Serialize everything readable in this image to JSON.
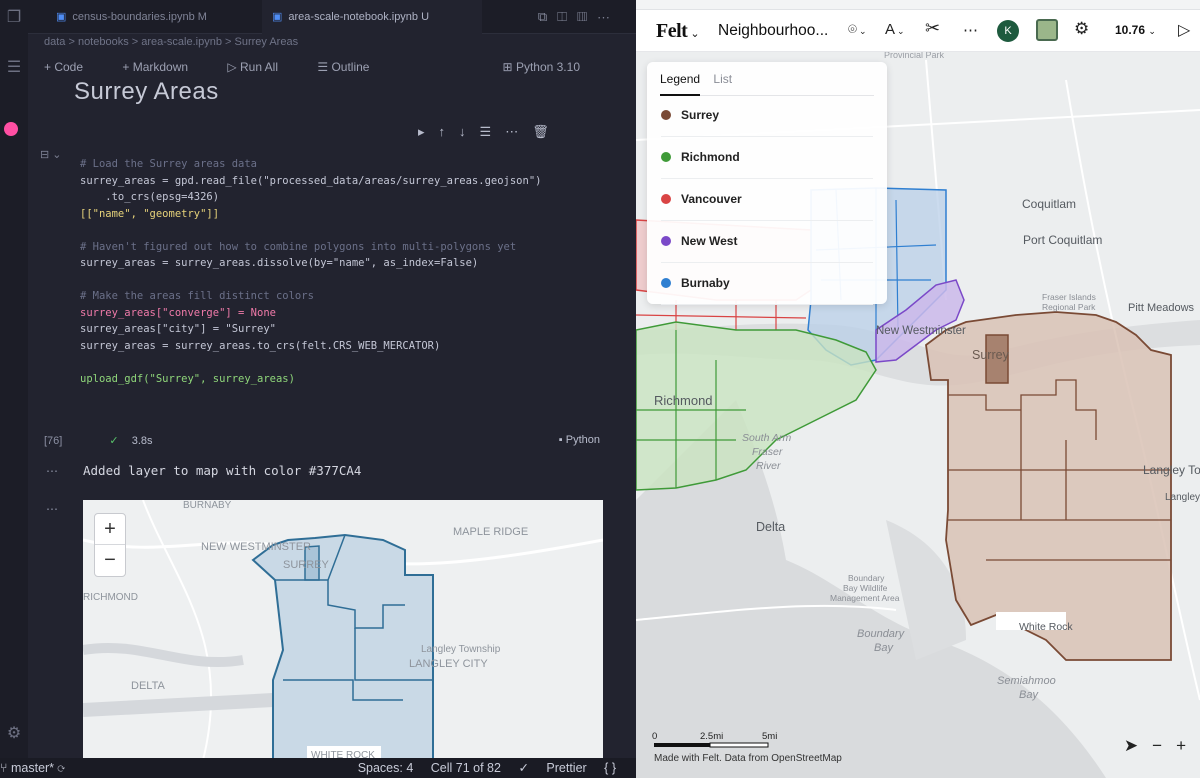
{
  "vscode": {
    "tabs": [
      {
        "label": "census-boundaries.ipynb M",
        "active": false
      },
      {
        "label": "area-scale-notebook.ipynb U",
        "active": true
      }
    ],
    "breadcrumb": "data > notebooks > area-scale.ipynb > Surrey Areas",
    "notebook_toolbar": {
      "code": "Code",
      "markdown": "Markdown",
      "run_all": "Run All",
      "outline": "Outline",
      "kernel": "Python 3.10"
    },
    "markdown_heading": "Surrey Areas",
    "code_lines": [
      {
        "cls": "c-comment",
        "text": "# Load the Surrey areas data"
      },
      {
        "cls": "c-var",
        "text": "surrey_areas = gpd.read_file(\"processed_data/areas/surrey_areas.geojson\")"
      },
      {
        "cls": "c-var",
        "text": "    .to_crs(epsg=4326)"
      },
      {
        "cls": "c-str",
        "text": "[[\"name\", \"geometry\"]]"
      },
      {
        "cls": "c-var",
        "text": ""
      },
      {
        "cls": "c-comment",
        "text": "# Haven't figured out how to combine polygons into multi-polygons yet"
      },
      {
        "cls": "c-var",
        "text": "surrey_areas = surrey_areas.dissolve(by=\"name\", as_index=False)"
      },
      {
        "cls": "c-var",
        "text": ""
      },
      {
        "cls": "c-comment",
        "text": "# Make the areas fill distinct colors"
      },
      {
        "cls": "c-pink",
        "text": "surrey_areas[\"converge\"] = None"
      },
      {
        "cls": "c-var",
        "text": "surrey_areas[\"city\"] = \"Surrey\""
      },
      {
        "cls": "c-var",
        "text": "surrey_areas = surrey_areas.to_crs(felt.CRS_WEB_MERCATOR)"
      },
      {
        "cls": "c-var",
        "text": ""
      },
      {
        "cls": "c-green",
        "text": "upload_gdf(\"Surrey\", surrey_areas)"
      }
    ],
    "cell_exec_count": "[76]",
    "cell_status": {
      "duration": "3.8s",
      "language": "Python"
    },
    "output_text": "Added layer to map with color  #377CA4",
    "mini_map": {
      "zoom_in": "+",
      "zoom_out": "−",
      "labels": [
        "BURNABY",
        "NEW WESTMINSTER",
        "MAPLE RIDGE",
        "SURREY",
        "RICHMOND",
        "Langley Township",
        "LANGLEY CITY",
        "DELTA",
        "WHITE ROCK"
      ],
      "fill_color": "#377CA4"
    },
    "statusbar": {
      "branch": "master*",
      "spaces": "Spaces: 4",
      "cell": "Cell 71 of 82",
      "prettier": "Prettier",
      "braces": "{ }"
    }
  },
  "felt": {
    "logo": "Felt",
    "map_title": "Neighbourhoo...",
    "zoom_level": "10.76",
    "avatar_initial": "K",
    "legend": {
      "tabs": [
        "Legend",
        "List"
      ],
      "items": [
        {
          "name": "Surrey",
          "color": "#7a4a35"
        },
        {
          "name": "Richmond",
          "color": "#3f9a38"
        },
        {
          "name": "Vancouver",
          "color": "#d94444"
        },
        {
          "name": "New West",
          "color": "#7b49c8"
        },
        {
          "name": "Burnaby",
          "color": "#2f7fd1"
        }
      ]
    },
    "place_labels": {
      "provincial_park": "Provincial Park",
      "coquitlam": "Coquitlam",
      "port_coquitlam": "Port Coquitlam",
      "fraser_islands": "Fraser Islands",
      "regional_park": "Regional Park",
      "pitt_meadows": "Pitt Meadows",
      "new_westminster": "New Westminster",
      "surrey": "Surrey",
      "richmond": "Richmond",
      "south_arm": "South Arm",
      "fraser": "Fraser",
      "river": "River",
      "langley_t": "Langley To",
      "langley": "Langley",
      "delta": "Delta",
      "boundary_bay_wma_1": "Boundary",
      "boundary_bay_wma_2": "Bay Wildlife",
      "boundary_bay_wma_3": "Management Area",
      "boundary_bay_1": "Boundary",
      "boundary_bay_2": "Bay",
      "white_rock": "White Rock",
      "semiahmoo_1": "Semiahmoo",
      "semiahmoo_2": "Bay"
    },
    "scale": {
      "zero": "0",
      "mid": "2.5mi",
      "end": "5mi"
    },
    "attribution": "Made with Felt. Data from OpenStreetMap"
  }
}
